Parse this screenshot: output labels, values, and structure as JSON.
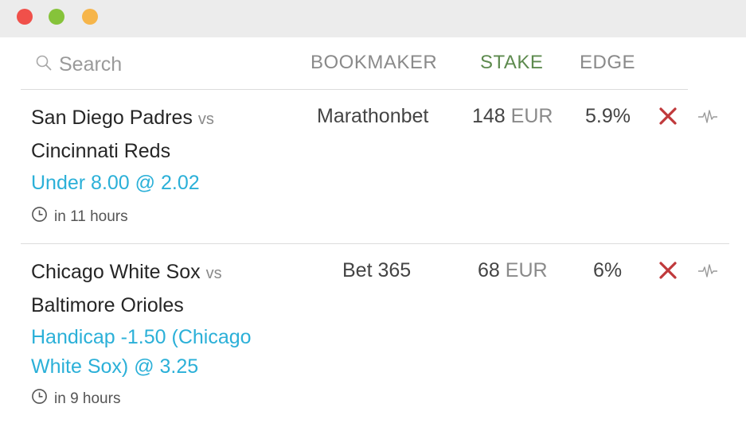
{
  "window": {
    "controls": [
      "close",
      "minimize",
      "maximize"
    ]
  },
  "search": {
    "placeholder": "Search",
    "icon": "search-icon"
  },
  "columns": {
    "bookmaker": "BOOKMAKER",
    "stake": "STAKE",
    "edge": "EDGE"
  },
  "colors": {
    "stake_active": "#5d8a4e",
    "market_link": "#2bb0d8",
    "remove": "#c0393b"
  },
  "bets": [
    {
      "team1": "San Diego Padres",
      "vs": "vs",
      "team2": "Cincinnati Reds",
      "market": "Under 8.00 @ 2.02",
      "time": "in 11 hours",
      "bookmaker": "Marathonbet",
      "stake_amount": "148",
      "stake_currency": "EUR",
      "edge": "5.9%"
    },
    {
      "team1": "Chicago White Sox",
      "vs": "vs",
      "team2": "Baltimore Orioles",
      "market": "Handicap -1.50 (Chicago White Sox) @ 3.25",
      "time": "in 9 hours",
      "bookmaker": "Bet 365",
      "stake_amount": "68",
      "stake_currency": "EUR",
      "edge": "6%"
    }
  ]
}
